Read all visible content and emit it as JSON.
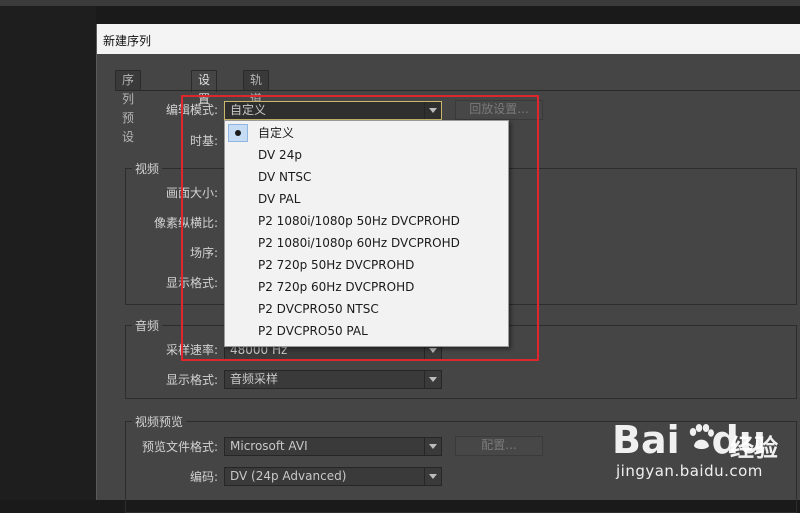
{
  "window": {
    "title": "新建序列"
  },
  "tabs": [
    {
      "label": "序列预设"
    },
    {
      "label": "设置"
    },
    {
      "label": "轨道"
    }
  ],
  "settings": {
    "edit_mode_label": "编辑模式:",
    "edit_mode_value": "自定义",
    "playback_settings_button": "回放设置...",
    "timebase_label": "时基:",
    "video": {
      "group_label": "视频",
      "frame_size_label": "画面大小:",
      "pixel_aspect_label": "像素纵横比:",
      "fields_label": "场序:",
      "display_format_label": "显示格式:"
    },
    "audio": {
      "group_label": "音频",
      "sample_rate_label": "采样速率:",
      "sample_rate_value": "48000 Hz",
      "display_format_label": "显示格式:",
      "display_format_value": "音频采样"
    },
    "video_preview": {
      "group_label": "视频预览",
      "preview_file_format_label": "预览文件格式:",
      "preview_file_format_value": "Microsoft AVI",
      "configure_button": "配置...",
      "codec_label": "编码:",
      "codec_value": "DV (24p Advanced)"
    }
  },
  "dropdown": {
    "selected_index": 0,
    "options": [
      "自定义",
      "DV 24p",
      "DV NTSC",
      "DV PAL",
      "P2 1080i/1080p 50Hz DVCPROHD",
      "P2 1080i/1080p 60Hz DVCPROHD",
      "P2 720p 50Hz DVCPROHD",
      "P2 720p 60Hz DVCPROHD",
      "P2 DVCPRO50 NTSC",
      "P2 DVCPRO50 PAL"
    ]
  },
  "highlight_color": "#e0262d",
  "watermark": {
    "logo_text": "Bai",
    "logo_suffix": "du",
    "brand_cn": "经验",
    "url": "jingyan.baidu.com"
  }
}
